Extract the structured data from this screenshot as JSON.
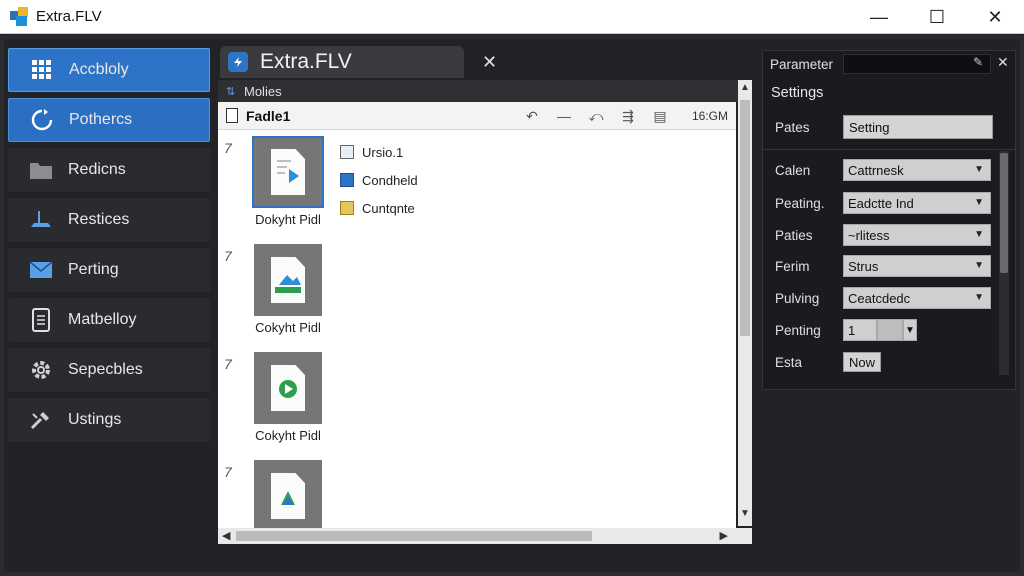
{
  "window": {
    "title": "Extra.FLV",
    "controls": {
      "minimize": "—",
      "maximize": "☐",
      "close": "✕"
    }
  },
  "sidebar": {
    "items": [
      {
        "label": "Accbloly",
        "icon": "grid-icon",
        "state": "active"
      },
      {
        "label": "Pothercs",
        "icon": "refresh-icon",
        "state": "active2"
      },
      {
        "label": "Redicns",
        "icon": "folder-icon",
        "state": ""
      },
      {
        "label": "Restices",
        "icon": "desk-icon",
        "state": ""
      },
      {
        "label": "Perting",
        "icon": "mail-icon",
        "state": ""
      },
      {
        "label": "Matbelloy",
        "icon": "document-icon",
        "state": ""
      },
      {
        "label": "Sepecbles",
        "icon": "gear-icon",
        "state": ""
      },
      {
        "label": "Ustings",
        "icon": "tools-icon",
        "state": ""
      }
    ]
  },
  "tab": {
    "label": "Extra.FLV",
    "close": "✕"
  },
  "subbar": {
    "label": "Molies"
  },
  "toolbar": {
    "title": "Fadle1",
    "size": "16:GM",
    "tools": [
      "↶",
      "—",
      "⤺",
      "⇶",
      "▤"
    ]
  },
  "files": [
    {
      "mark": "7",
      "caption": "Dokyht Pidl",
      "kind": "video",
      "selected": true
    },
    {
      "mark": "7",
      "caption": "Cokyht Pidl",
      "kind": "image",
      "selected": false
    },
    {
      "mark": "7",
      "caption": "Cokyht Pidl",
      "kind": "play",
      "selected": false
    },
    {
      "mark": "7",
      "caption": "",
      "kind": "chart",
      "selected": false
    }
  ],
  "file_list": [
    {
      "label": "Ursio.1"
    },
    {
      "label": "Condheld"
    },
    {
      "label": "Cuntqnte"
    }
  ],
  "parameter_panel": {
    "title": "Parameter",
    "section": "Settings",
    "rows": [
      {
        "label": "Pates",
        "value": "Setting",
        "type": "button"
      },
      {
        "label": "Calen",
        "value": "Cattrnesk",
        "type": "select"
      },
      {
        "label": "Peating.",
        "value": "Eadctte Ind",
        "type": "select"
      },
      {
        "label": "Paties",
        "value": "~rlitess",
        "type": "select"
      },
      {
        "label": "Ferim",
        "value": "Strus",
        "type": "select"
      },
      {
        "label": "Pulving",
        "value": "Ceatcdedc",
        "type": "select"
      },
      {
        "label": "Penting",
        "value": "1",
        "type": "stepper"
      },
      {
        "label": "Esta",
        "value": "Now",
        "type": "small-button"
      }
    ]
  },
  "colors": {
    "accent": "#2d74c8",
    "background": "#1f2023"
  }
}
